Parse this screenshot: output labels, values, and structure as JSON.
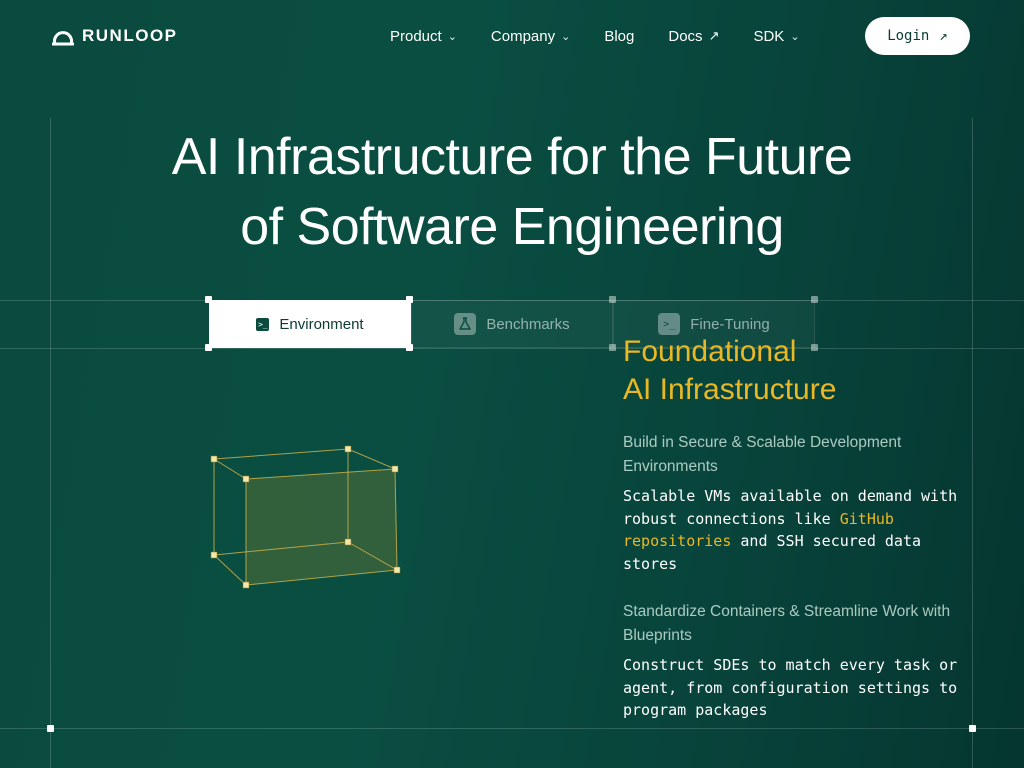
{
  "brand": {
    "name": "RUNLOOP"
  },
  "nav": {
    "items": [
      {
        "label": "Product",
        "icon": "chevron-down-icon"
      },
      {
        "label": "Company",
        "icon": "chevron-down-icon"
      },
      {
        "label": "Blog"
      },
      {
        "label": "Docs",
        "icon": "arrow-up-right-icon"
      },
      {
        "label": "SDK",
        "icon": "chevron-down-icon"
      }
    ],
    "login_label": "Login"
  },
  "hero": {
    "title_line1": "AI Infrastructure for the Future",
    "title_line2": "of Software Engineering"
  },
  "tabs": [
    {
      "label": "Environment",
      "icon": "terminal-icon",
      "active": true
    },
    {
      "label": "Benchmarks",
      "icon": "flask-icon",
      "active": false
    },
    {
      "label": "Fine-Tuning",
      "icon": "terminal-icon",
      "active": false
    }
  ],
  "panel": {
    "heading_line1": "Foundational",
    "heading_line2": "AI Infrastructure",
    "features": [
      {
        "subtitle": "Build in Secure & Scalable Development Environments",
        "text_before": "Scalable VMs available on demand with robust connections like ",
        "link": "GitHub repositories",
        "text_after": " and SSH secured data stores"
      },
      {
        "subtitle": "Standardize Containers & Streamline Work with Blueprints",
        "text": "Construct SDEs to match every task or agent, from configuration settings to program packages"
      }
    ]
  },
  "colors": {
    "background": "#0b4a3e",
    "accent": "#e9b824",
    "text": "#ffffff",
    "login_bg": "#ffffff"
  }
}
